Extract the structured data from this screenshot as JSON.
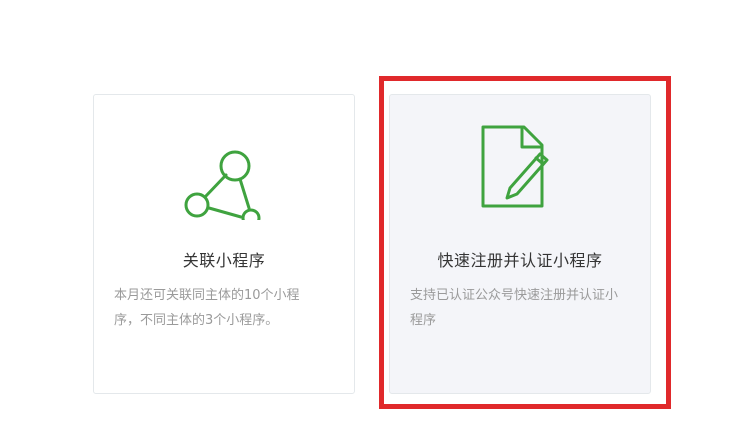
{
  "cards": [
    {
      "id": "related",
      "title": "关联小程序",
      "description": "本月还可关联同主体的10个小程序，不同主体的3个小程序。",
      "icon": "share-network-icon",
      "selected": false
    },
    {
      "id": "register",
      "title": "快速注册并认证小程序",
      "description": "支持已认证公众号快速注册并认证小程序",
      "icon": "document-edit-icon",
      "selected": true
    }
  ],
  "colors": {
    "accent": "#3fa33f",
    "highlight": "#e0292b",
    "title": "#353535",
    "description": "#9a9a9a",
    "selected_card_bg": "#f4f5f9",
    "card_border": "#e4e8eb"
  }
}
